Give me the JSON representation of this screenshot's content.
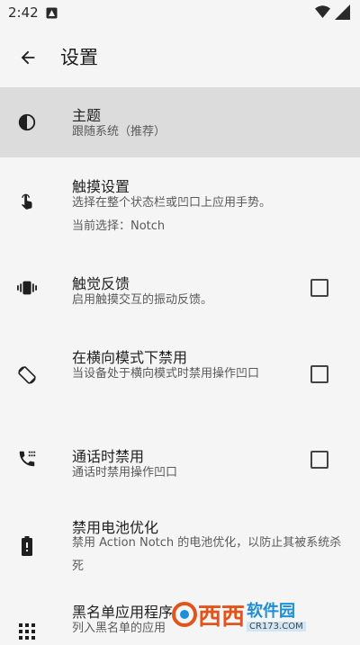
{
  "status": {
    "time": "2:42"
  },
  "app_bar": {
    "title": "设置"
  },
  "items": [
    {
      "title": "主题",
      "desc": "跟随系统（推荐）",
      "icon": "contrast-icon",
      "selected": true
    },
    {
      "title": "触摸设置",
      "desc": "选择在整个状态栏或凹口上应用手势。",
      "extra": "当前选择：Notch",
      "icon": "touch-hand-icon"
    },
    {
      "title": "触觉反馈",
      "desc": "启用触摸交互的振动反馈。",
      "icon": "vibration-icon",
      "checked": false
    },
    {
      "title": "在横向模式下禁用",
      "desc": "当设备处于横向模式时禁用操作凹口",
      "icon": "screen-rotation-icon",
      "checked": false
    },
    {
      "title": "通话时禁用",
      "desc": "通话时禁用操作凹口",
      "icon": "phone-in-talk-icon",
      "checked": false
    },
    {
      "title": "禁用电池优化",
      "desc": "禁用 Action Notch 的电池优化，以防止其被系统杀死",
      "icon": "battery-icon"
    },
    {
      "title": "黑名单应用程序",
      "desc": "列入黑名单的应用",
      "icon": "apps-grid-icon"
    }
  ],
  "watermark": {
    "logo": "西西",
    "line1": "软件园",
    "line2": "CR173.COM"
  }
}
